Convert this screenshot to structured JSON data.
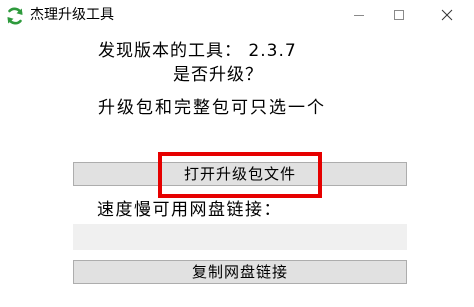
{
  "window": {
    "title": "杰理升级工具"
  },
  "content": {
    "version_line": "发现版本的工具： 2.3.7",
    "question_line": "是否升级？",
    "choice_line": "升级包和完整包可只选一个",
    "slow_line": "速度慢可用网盘链接："
  },
  "buttons": {
    "open_package_label": "打开升级包文件",
    "copy_link_label": "复制网盘链接"
  },
  "link_field": {
    "value": ""
  },
  "colors": {
    "highlight": "#e60000",
    "button_face": "#e1e1e1",
    "button_border": "#adadad",
    "app_icon_green": "#2e9a3c"
  },
  "icons": {
    "app": "refresh-arrows-icon",
    "minimize": "minimize-icon",
    "maximize": "maximize-icon",
    "close": "close-icon"
  }
}
